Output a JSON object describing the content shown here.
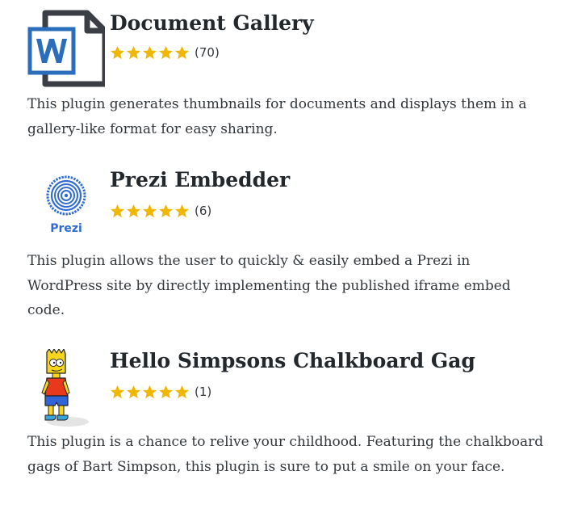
{
  "accent_star_color": "#f0b700",
  "plugins": [
    {
      "icon": "word-document-icon",
      "title": "Document Gallery",
      "rating_stars": 5,
      "rating_count": "(70)",
      "description": "This plugin generates thumbnails for documents and displays them in a gallery-like format for easy sharing."
    },
    {
      "icon": "prezi-logo-icon",
      "icon_text": "Prezi",
      "title": "Prezi Embedder",
      "rating_stars": 5,
      "rating_count": "(6)",
      "description": "This plugin allows the user to quickly & easily embed a Prezi in WordPress site by directly implementing the published iframe embed code."
    },
    {
      "icon": "bart-simpson-icon",
      "title": "Hello Simpsons Chalkboard Gag",
      "rating_stars": 5,
      "rating_count": "(1)",
      "description": "This plugin is a chance to relive your childhood. Featuring the chalkboard gags of Bart Simpson, this plugin is sure to put a smile on your face."
    }
  ]
}
